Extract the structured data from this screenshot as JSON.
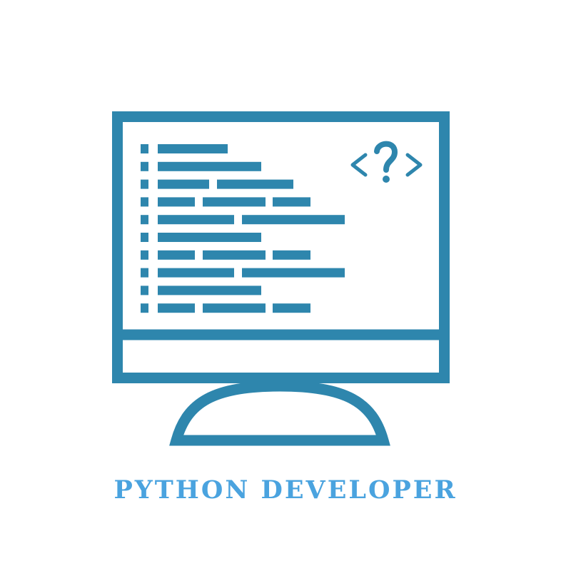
{
  "caption": "PYTHON DEVELOPER",
  "icon": {
    "name": "computer-monitor-code-icon",
    "symbol": "<?>",
    "code_lines": 10
  },
  "colors": {
    "stroke": "#2e86ad",
    "caption": "#4aa3df",
    "background": "#ffffff"
  }
}
